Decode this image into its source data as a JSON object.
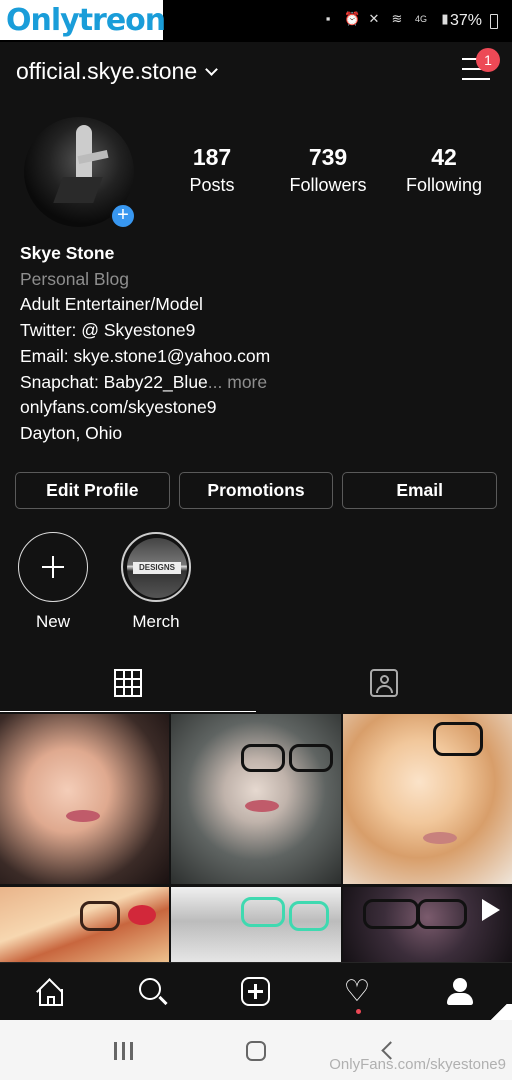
{
  "watermark": {
    "part1": "Only",
    "part2": "treon",
    "bottom": "OnlyFans.com/skyestone9"
  },
  "status": {
    "battery": "37%",
    "network": "4G"
  },
  "header": {
    "username": "official.skye.stone",
    "notification_count": "1"
  },
  "stats": [
    {
      "value": "187",
      "label": "Posts"
    },
    {
      "value": "739",
      "label": "Followers"
    },
    {
      "value": "42",
      "label": "Following"
    }
  ],
  "bio": {
    "name": "Skye Stone",
    "category": "Personal Blog",
    "line1": "Adult Entertainer/Model",
    "line2": "Twitter: @ Skyestone9",
    "line3": "Email: skye.stone1@yahoo.com",
    "line4": "Snapchat: Baby22_Blue",
    "more": "... more",
    "link": "onlyfans.com/skyestone9",
    "location": "Dayton, Ohio"
  },
  "buttons": {
    "edit": "Edit Profile",
    "promotions": "Promotions",
    "email": "Email"
  },
  "highlights": {
    "new": "New",
    "merch": "Merch",
    "merch_cover_text": "DESIGNS"
  },
  "colors": {
    "background": "#121212",
    "accent_blue": "#3897f0",
    "notification_red": "#ed4956",
    "watermark_blue": "#1a9dd9"
  },
  "icons": [
    "home-icon",
    "search-icon",
    "add-post-icon",
    "heart-icon",
    "profile-icon",
    "grid-icon",
    "tagged-icon",
    "menu-icon",
    "play-icon"
  ]
}
